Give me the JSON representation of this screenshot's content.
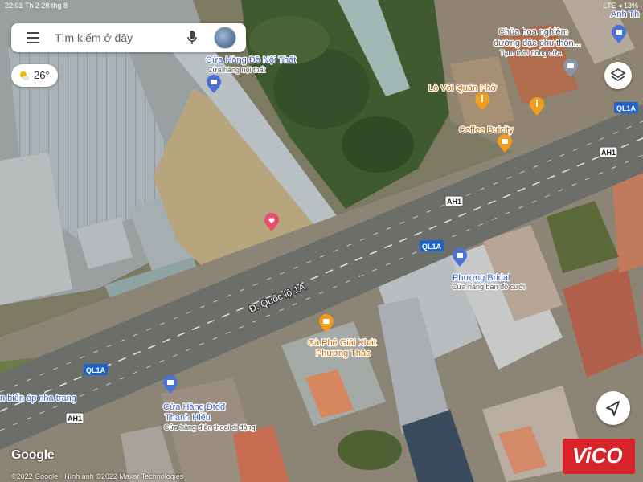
{
  "status_bar": {
    "time": "22:01  Th 2 28 thg 8",
    "right": "LTE  ◂  13%"
  },
  "search": {
    "placeholder": "Tìm kiếm ở đây"
  },
  "weather": {
    "temperature": "26°"
  },
  "road": {
    "name": "Đ. Quốc lộ 1A"
  },
  "shields": [
    {
      "text": "QL1A",
      "type": "blue"
    },
    {
      "text": "AH1",
      "type": "white"
    },
    {
      "text": "AH1",
      "type": "white"
    },
    {
      "text": "QL1A",
      "type": "blue"
    },
    {
      "text": "QL1A",
      "type": "blue"
    },
    {
      "text": "AH1",
      "type": "white"
    }
  ],
  "places": [
    {
      "name": "Cửa Hàng Đồ Nội Thất",
      "sub": "Cửa hàng nội thất",
      "icon": "shopping-bag-icon",
      "color": "#4a72d6"
    },
    {
      "name": "Chùa hoa nghiêm",
      "name2": "đường đặc phu thôn...",
      "sub": "Tạm thời đóng cửa",
      "icon": "temple-icon",
      "color": "#8a96a8"
    },
    {
      "name": "Anh Th",
      "icon": "shopping-bag-icon",
      "color": "#4a72d6"
    },
    {
      "name": "Lò Vôi Quán Phở",
      "icon": "restaurant-icon",
      "color": "#f29c1f"
    },
    {
      "name": "Coffee Buicity",
      "icon": "coffee-icon",
      "color": "#f29c1f"
    },
    {
      "name": "Phượng Bridal",
      "sub": "Cửa hàng bán đồ cưới",
      "icon": "shopping-bag-icon",
      "color": "#4a72d6"
    },
    {
      "name": "Cà Phê Giải Khát",
      "name2": "Phương Thảo",
      "icon": "coffee-icon",
      "color": "#f29c1f"
    },
    {
      "name": "Cửa Hàng Đtdđ",
      "name2": "Thanh Hiếu",
      "sub": "Cửa hàng điện thoại di động",
      "icon": "shopping-bag-icon",
      "color": "#4a72d6"
    },
    {
      "name": "n biển áp nha trang"
    },
    {
      "name": "",
      "icon": "saved-heart-icon",
      "color": "#e8506a"
    }
  ],
  "branding": {
    "google": "Google",
    "copyright": "©2022 Google · Hình ảnh ©2022 Maxar Technologies",
    "watermark": "ViCO"
  },
  "colors": {
    "road": "#6c6e6a",
    "shield_blue": "#1f63c9",
    "poi_blue": "#4a72d6",
    "poi_orange": "#f29c1f",
    "vico_red": "#d9232a"
  }
}
